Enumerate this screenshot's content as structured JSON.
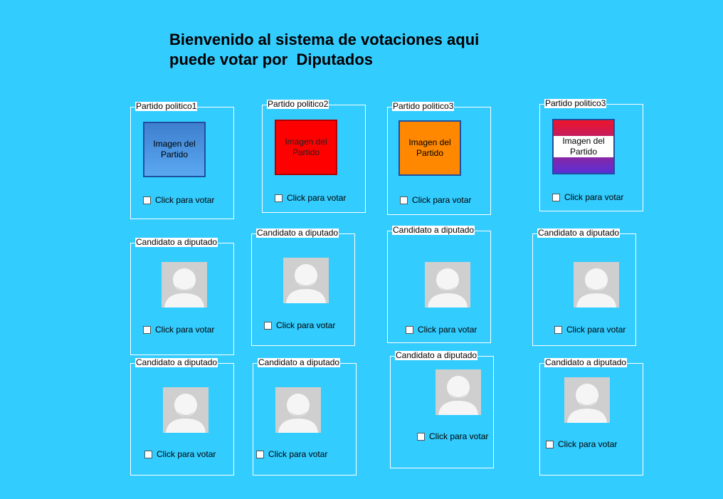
{
  "title": {
    "line1": "Bienvenido al sistema de votaciones aqui",
    "line2": "puede votar por  Diputados"
  },
  "parties": [
    {
      "legend": "Partido politico1",
      "image_label": "Imagen del Partido",
      "vote_label": "Click para votar",
      "color": "#4d94e6"
    },
    {
      "legend": "Partido politico2",
      "image_label": "Imagen del Partido",
      "vote_label": "Click para votar",
      "color": "#ff0000"
    },
    {
      "legend": "Partido politico3",
      "image_label": "Imagen del Partido",
      "vote_label": "Click para votar",
      "color": "#ff8800"
    },
    {
      "legend": "Partido politico3",
      "image_label": "Imagen del Partido",
      "vote_label": "Click para votar",
      "color": "#a020a0"
    }
  ],
  "candidates_row1": [
    {
      "legend": "Candidato a diputado",
      "vote_label": "Click para votar"
    },
    {
      "legend": "Candidato a diputado",
      "vote_label": "Click para votar"
    },
    {
      "legend": "Candidato a diputado",
      "vote_label": "Click para votar"
    },
    {
      "legend": "Candidato a diputado",
      "vote_label": "Click para votar"
    }
  ],
  "candidates_row2": [
    {
      "legend": "Candidato a diputado",
      "vote_label": "Click para votar"
    },
    {
      "legend": "Candidato a diputado",
      "vote_label": "Click para votar"
    },
    {
      "legend": "Candidato a diputado",
      "vote_label": "Click para votar"
    },
    {
      "legend": "Candidato a diputado",
      "vote_label": "Click para votar"
    }
  ],
  "avatar_icon": "default-user-avatar-icon",
  "colors": {
    "background": "#33ccff",
    "group_border": "#ffffff"
  }
}
